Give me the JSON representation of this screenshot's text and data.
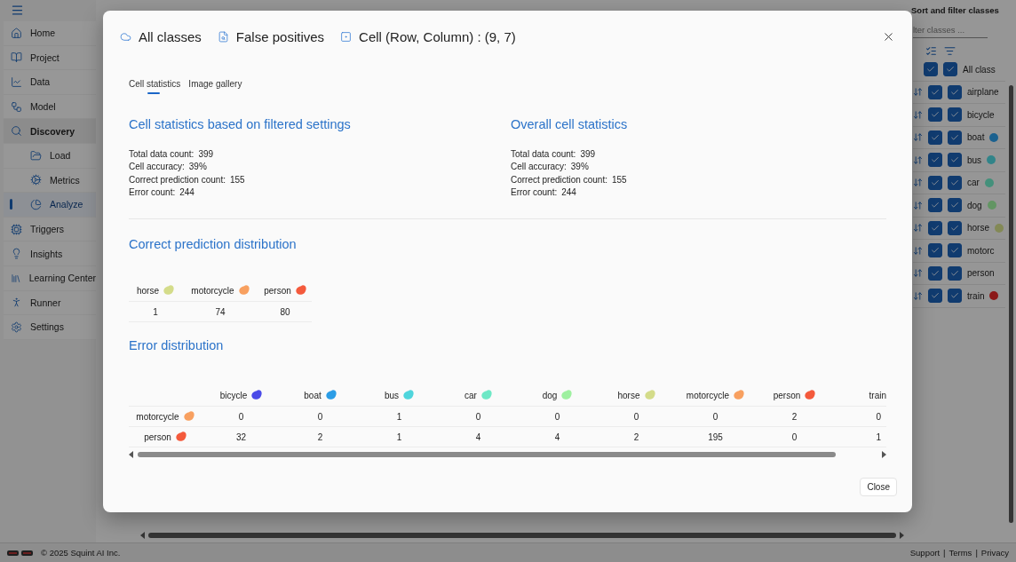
{
  "sidebar": {
    "items": [
      {
        "label": "Home",
        "selected": false
      },
      {
        "label": "Project",
        "selected": false
      },
      {
        "label": "Data",
        "selected": false
      },
      {
        "label": "Model",
        "selected": false
      },
      {
        "label": "Discovery",
        "selected": false,
        "expanded": true,
        "children": [
          {
            "label": "Load",
            "selected": false
          },
          {
            "label": "Metrics",
            "selected": false
          },
          {
            "label": "Analyze",
            "selected": true
          }
        ]
      },
      {
        "label": "Triggers",
        "selected": false
      },
      {
        "label": "Insights",
        "selected": false
      },
      {
        "label": "Learning Center",
        "selected": false
      },
      {
        "label": "Runner",
        "selected": false
      },
      {
        "label": "Settings",
        "selected": false
      }
    ]
  },
  "class_filter": {
    "title": "Sort and filter classes",
    "placeholder": "lter classes ...",
    "all": {
      "label": "All class",
      "checkboxes": [
        {
          "checked": true
        },
        {
          "checked": true
        }
      ]
    },
    "classes": [
      {
        "name": "airplane",
        "checkboxes": [
          {
            "checked": true
          },
          {
            "checked": true
          }
        ]
      },
      {
        "name": "bicycle",
        "checkboxes": [
          {
            "checked": true
          },
          {
            "checked": true
          }
        ]
      },
      {
        "name": "boat",
        "color": "#1b618f",
        "checkboxes": [
          {
            "checked": true
          },
          {
            "checked": true
          }
        ]
      },
      {
        "name": "bus",
        "color": "#318489",
        "checkboxes": [
          {
            "checked": true
          },
          {
            "checked": true
          }
        ]
      },
      {
        "name": "car",
        "color": "#44907b",
        "checkboxes": [
          {
            "checked": true
          },
          {
            "checked": true
          }
        ]
      },
      {
        "name": "dog",
        "color": "#629563",
        "checkboxes": [
          {
            "checked": true
          },
          {
            "checked": true
          }
        ]
      },
      {
        "name": "horse",
        "color": "#838956",
        "checkboxes": [
          {
            "checked": true
          },
          {
            "checked": true
          }
        ]
      },
      {
        "name": "motorc",
        "checkboxes": [
          {
            "checked": true
          },
          {
            "checked": true
          }
        ]
      },
      {
        "name": "person",
        "checkboxes": [
          {
            "checked": true
          },
          {
            "checked": true
          }
        ]
      },
      {
        "name": "train",
        "color": "#8b1919",
        "checkboxes": [
          {
            "checked": true
          },
          {
            "checked": true
          }
        ]
      }
    ]
  },
  "dialog": {
    "breadcrumbs": [
      {
        "kind": "classes",
        "label": "All classes"
      },
      {
        "kind": "filter",
        "label": "False positives"
      },
      {
        "kind": "cell",
        "label": "Cell (Row, Column) : (9, 7)"
      }
    ],
    "tabs": [
      {
        "label": "Cell statistics",
        "selected": true
      },
      {
        "label": "Image gallery",
        "selected": false
      }
    ],
    "stat_sections": [
      {
        "title": "Cell statistics based on filtered settings",
        "rows": [
          {
            "label": "Total data count:",
            "value": "399"
          },
          {
            "label": "Cell accuracy:",
            "value": "39%"
          },
          {
            "label": "Correct prediction count:",
            "value": "155"
          },
          {
            "label": "Error count:",
            "value": "244"
          }
        ]
      },
      {
        "title": "Overall cell statistics",
        "rows": [
          {
            "label": "Total data count:",
            "value": "399"
          },
          {
            "label": "Cell accuracy:",
            "value": "39%"
          },
          {
            "label": "Correct prediction count:",
            "value": "155"
          },
          {
            "label": "Error count:",
            "value": "244"
          }
        ]
      }
    ],
    "correct_distribution": {
      "title": "Correct prediction distribution",
      "columns": [
        {
          "name": "horse",
          "color": "#d4dc8a"
        },
        {
          "name": "motorcycle",
          "color": "#f8a060"
        },
        {
          "name": "person",
          "color": "#f45a3c"
        }
      ],
      "values": [
        "1",
        "74",
        "80"
      ]
    },
    "error_distribution": {
      "title": "Error distribution",
      "columns": [
        {
          "name": "bicycle",
          "color": "#4b4be8"
        },
        {
          "name": "boat",
          "color": "#2c9de6"
        },
        {
          "name": "bus",
          "color": "#4fd5dc"
        },
        {
          "name": "car",
          "color": "#6ee8c6"
        },
        {
          "name": "dog",
          "color": "#9ef0a0"
        },
        {
          "name": "horse",
          "color": "#d4dc8a"
        },
        {
          "name": "motorcycle",
          "color": "#f8a060"
        },
        {
          "name": "person",
          "color": "#f45a3c"
        },
        {
          "name": "train"
        }
      ],
      "rows": [
        {
          "name": "motorcycle",
          "color": "#f8a060",
          "values": [
            "0",
            "0",
            "1",
            "0",
            "0",
            "0",
            "0",
            "2",
            "0"
          ]
        },
        {
          "name": "person",
          "color": "#f45a3c",
          "values": [
            "32",
            "2",
            "1",
            "4",
            "4",
            "2",
            "195",
            "0",
            "1"
          ]
        }
      ]
    },
    "close_button": "Close"
  },
  "footer": {
    "copyright": "© 2025 Squint AI Inc.",
    "separator": "|",
    "links": [
      "Support",
      "Terms",
      "Privacy"
    ]
  }
}
